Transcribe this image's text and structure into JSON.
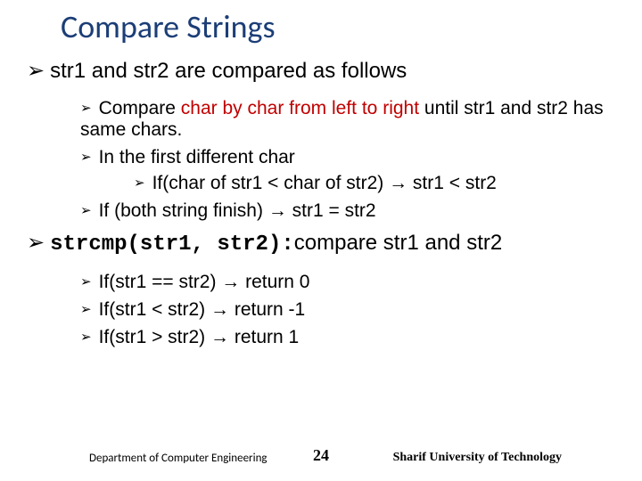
{
  "title": "Compare Strings",
  "bullets": {
    "b1": "str1 and str2 are compared as follows",
    "b1a_pre": "Compare ",
    "b1a_red": "char by char from left to right",
    "b1a_post": " until str1 and str2 has same chars.",
    "b1b": "In the first different char",
    "b1b_i": "If(char of str1 < char of str2) → str1 < str2",
    "b1c": "If (both string finish) → str1 = str2",
    "b2_code": "strcmp(str1, str2):",
    "b2_post": "compare str1 and str2",
    "b2a": "If(str1 == str2) → return 0",
    "b2b": "If(str1 < str2) → return -1",
    "b2c": "If(str1 > str2) → return 1"
  },
  "footer": {
    "left": "Department of Computer Engineering",
    "page": "24",
    "right": "Sharif University of Technology"
  },
  "glyphs": {
    "tri": "➢"
  }
}
